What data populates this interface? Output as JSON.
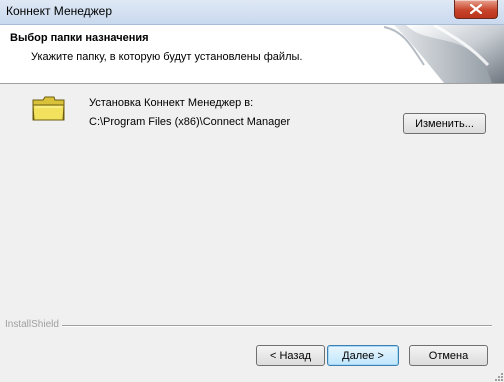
{
  "window": {
    "title": "Коннект Менеджер"
  },
  "header": {
    "title": "Выбор папки назначения",
    "subtitle": "Укажите папку, в которую будут установлены файлы."
  },
  "install": {
    "label": "Установка Коннект Менеджер в:",
    "path": "C:\\Program Files (x86)\\Connect Manager",
    "change_label": "Изменить..."
  },
  "footer": {
    "brand": "InstallShield",
    "back_label": "< Назад",
    "next_label": "Далее >",
    "cancel_label": "Отмена"
  },
  "colors": {
    "folder": "#f2e15c",
    "close_button": "#c8462c",
    "default_button_border": "#3c7fb1"
  },
  "icons": {
    "close": "close-icon",
    "folder": "folder-icon"
  }
}
